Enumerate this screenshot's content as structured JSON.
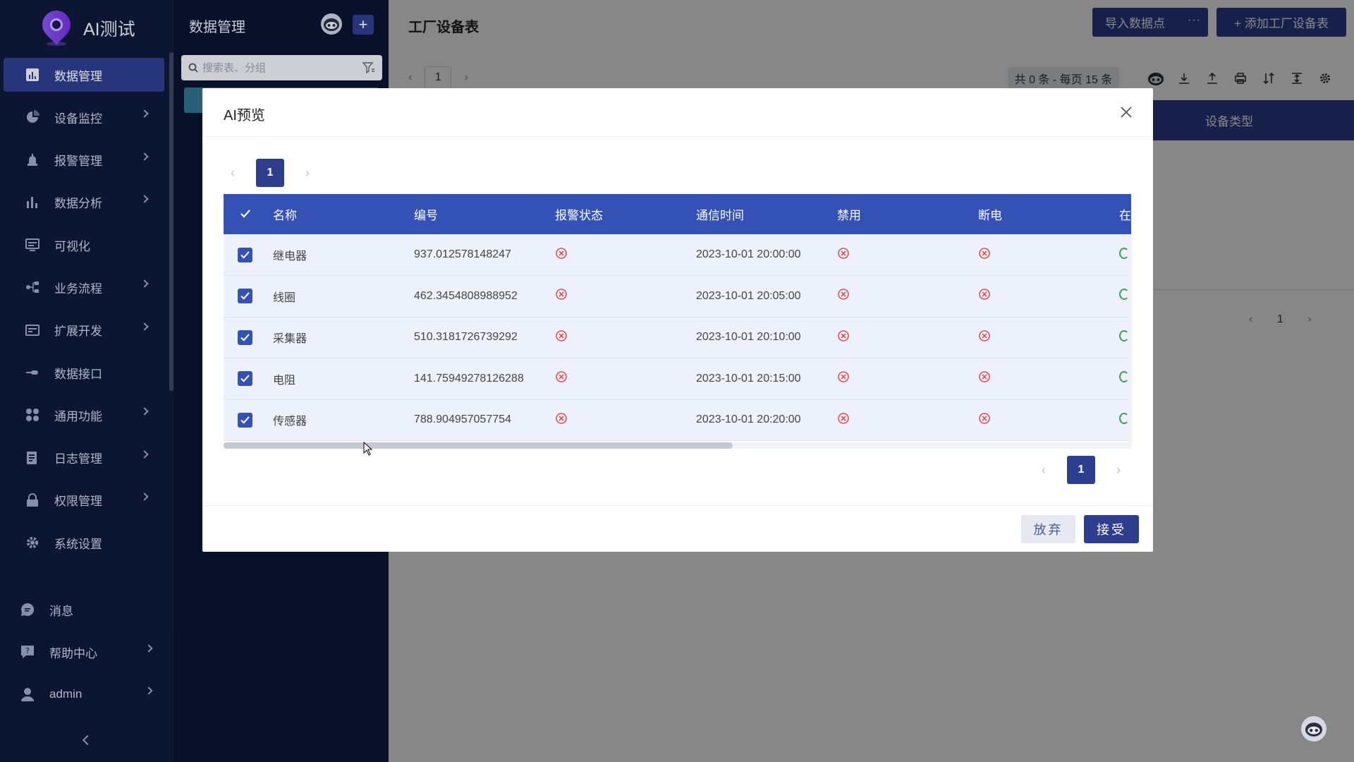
{
  "brand": {
    "name": "AI测试"
  },
  "nav": {
    "items": [
      {
        "label": "数据管理",
        "icon": "chart-bar-icon",
        "active": true,
        "hasChildren": false
      },
      {
        "label": "设备监控",
        "icon": "monitor-icon",
        "hasChildren": true
      },
      {
        "label": "报警管理",
        "icon": "alarm-icon",
        "hasChildren": true
      },
      {
        "label": "数据分析",
        "icon": "analysis-icon",
        "hasChildren": true
      },
      {
        "label": "可视化",
        "icon": "screen-icon",
        "hasChildren": false
      },
      {
        "label": "业务流程",
        "icon": "flow-icon",
        "hasChildren": true
      },
      {
        "label": "扩展开发",
        "icon": "extend-icon",
        "hasChildren": true
      },
      {
        "label": "数据接口",
        "icon": "api-icon",
        "hasChildren": false
      },
      {
        "label": "通用功能",
        "icon": "apps-icon",
        "hasChildren": true
      },
      {
        "label": "日志管理",
        "icon": "log-icon",
        "hasChildren": true
      },
      {
        "label": "权限管理",
        "icon": "lock-icon",
        "hasChildren": true
      },
      {
        "label": "系统设置",
        "icon": "gear-icon",
        "hasChildren": false
      }
    ],
    "bottom": [
      {
        "label": "消息",
        "icon": "message-icon",
        "hasChildren": false
      },
      {
        "label": "帮助中心",
        "icon": "help-icon",
        "hasChildren": true
      },
      {
        "label": "admin",
        "icon": "user-icon",
        "hasChildren": true
      }
    ]
  },
  "panel": {
    "title": "数据管理",
    "search_placeholder": "搜索表、分组"
  },
  "main": {
    "title": "工厂设备表",
    "import_label": "导入数据点",
    "import_more": "···",
    "add_label": "+ 添加工厂设备表",
    "page_current": "1",
    "count_text": "共 0 条 - 每页 15 条",
    "visible_column": "设备类型",
    "page_current_right": "1"
  },
  "modal": {
    "title": "AI预览",
    "page_current": "1",
    "columns": [
      "名称",
      "编号",
      "报警状态",
      "通信时间",
      "禁用",
      "断电",
      "在"
    ],
    "rows": [
      {
        "name": "继电器",
        "code": "937.012578148247",
        "time": "2023-10-01 20:00:00"
      },
      {
        "name": "线圈",
        "code": "462.3454808988952",
        "time": "2023-10-01 20:05:00"
      },
      {
        "name": "采集器",
        "code": "510.3181726739292",
        "time": "2023-10-01 20:10:00"
      },
      {
        "name": "电阻",
        "code": "141.75949278126288",
        "time": "2023-10-01 20:15:00"
      },
      {
        "name": "传感器",
        "code": "788.904957057754",
        "time": "2023-10-01 20:20:00"
      }
    ],
    "page_current_bottom": "1",
    "discard_label": "放弃",
    "accept_label": "接受"
  },
  "colors": {
    "accent": "#2d3e8e",
    "table_header": "#3451b6",
    "error_red": "#e05050",
    "ok_green": "#3aa24a"
  }
}
